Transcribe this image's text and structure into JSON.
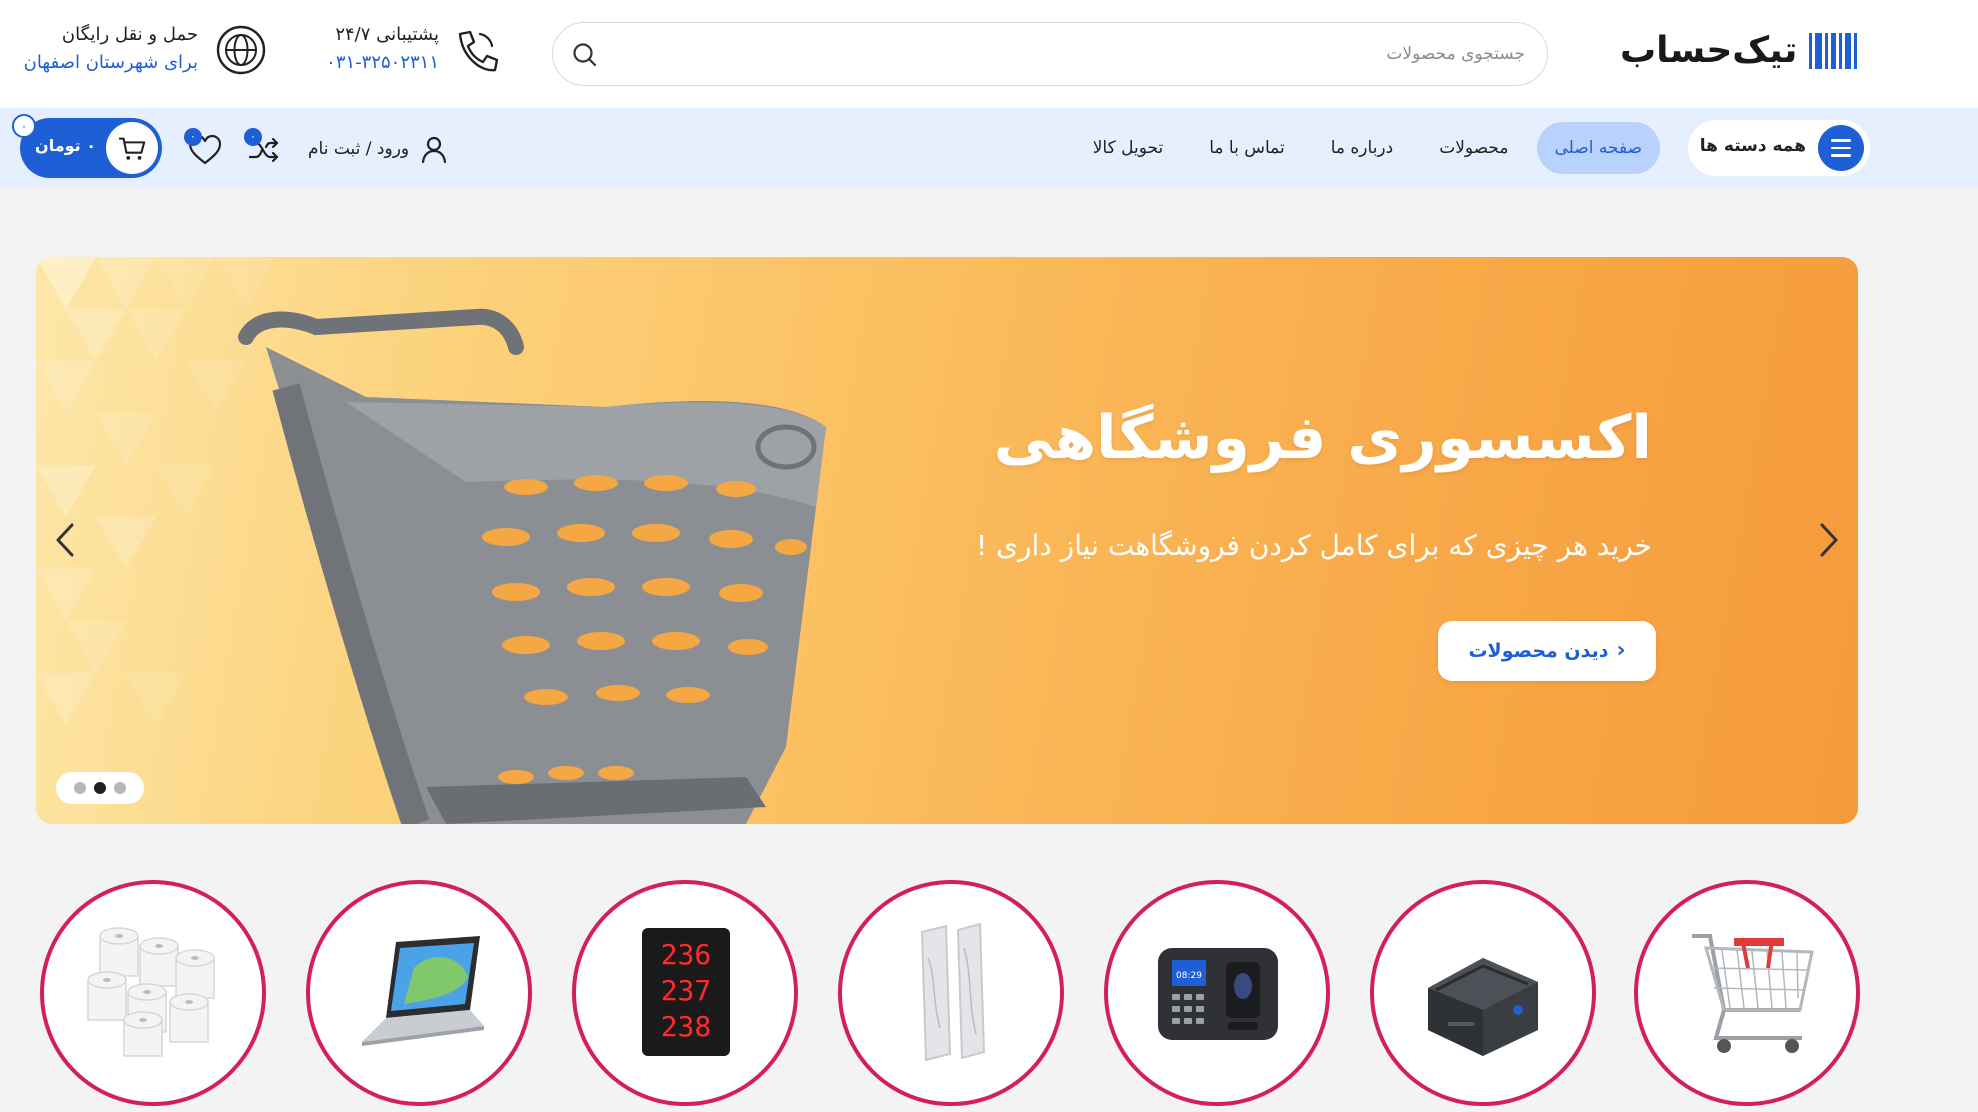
{
  "header": {
    "logo_text": "تیک‌حساب",
    "search": {
      "placeholder": "جستجوی محصولات"
    },
    "support": {
      "title": "پشتیبانی ۲۴/۷",
      "phone": "۰۳۱-۳۲۵۰۲۳۱۱"
    },
    "shipping": {
      "title": "حمل و نقل رایگان",
      "subtitle": "برای شهرستان اصفهان"
    }
  },
  "nav": {
    "all_categories": "همه دسته ها",
    "items": [
      {
        "label": "صفحه اصلی",
        "active": true
      },
      {
        "label": "محصولات",
        "active": false
      },
      {
        "label": "درباره ما",
        "active": false
      },
      {
        "label": "تماس با ما",
        "active": false
      },
      {
        "label": "تحویل کالا",
        "active": false
      }
    ],
    "login_label": "ورود / ثبت نام",
    "compare_count": "۰",
    "wishlist_count": "۰",
    "cart_price": "۰ تومان",
    "cart_count": "۰"
  },
  "hero": {
    "title": "اکسسوری فروشگاهی",
    "subtitle": "خرید هر چیزی که برای کامل کردن فروشگاهت نیاز داری !",
    "cta_label": "دیدن محصولات",
    "slide_count": 3,
    "active_slide": 2
  },
  "categories": [
    {
      "icon": "shopping-cart"
    },
    {
      "icon": "label-printer"
    },
    {
      "icon": "attendance-device"
    },
    {
      "icon": "security-gate-antenna"
    },
    {
      "icon": "queue-number-display",
      "display_numbers": [
        "236",
        "237",
        "238"
      ]
    },
    {
      "icon": "laptop"
    },
    {
      "icon": "thermal-paper-rolls"
    }
  ],
  "colors": {
    "accent": "#1f5fd6",
    "nav_bg": "#e6effd",
    "active_tab_bg": "#b9d2fb",
    "circle_border": "#d41f5f",
    "hero_orange": "#f8a948"
  }
}
